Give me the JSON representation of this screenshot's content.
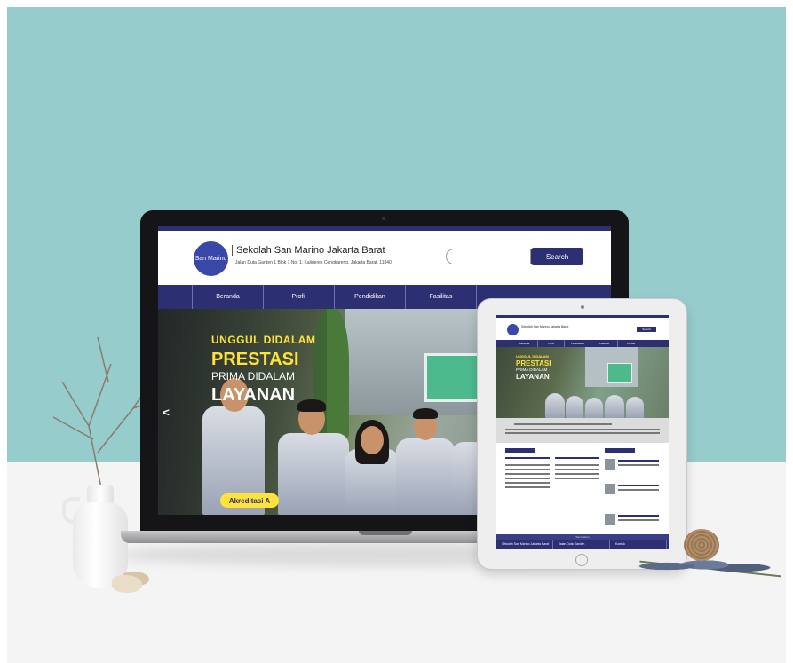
{
  "laptop_site": {
    "logo_text": "San Marino",
    "school_name": "Sekolah San Marino Jakarta Barat",
    "address": "Jalan Duta Garden 1 Blok 1 No. 1, Kalideres Cengkareng, Jakarta Barat, 11840",
    "search_button": "Search",
    "nav": [
      "Beranda",
      "Profil",
      "Pendidikan",
      "Fasilitas",
      ""
    ],
    "hero": {
      "line1": "UNGGUL DIDALAM",
      "line2": "PRESTASI",
      "line3": "PRIMA DIDALAM",
      "line4": "LAYANAN",
      "badge": "Akreditasi A",
      "prev_arrow": "<"
    }
  },
  "tablet_site": {
    "school_name": "Sekolah San Marino Jakarta Barat",
    "search_button": "Search",
    "nav": [
      "Beranda",
      "Profil",
      "Pendidikan",
      "Fasilitas",
      "Kontak"
    ],
    "hero": {
      "line1": "UNGGUL DIDALAM",
      "line2": "PRESTASI",
      "line3": "PRIMA DIDALAM",
      "line4": "LAYANAN"
    },
    "footer_bar": "San Marino",
    "footer": [
      "Sekolah San Marino Jakarta Barat",
      "Jalan Duta Garden",
      "Kontak"
    ]
  },
  "colors": {
    "brand_navy": "#2c2f72",
    "logo_blue": "#3948a8",
    "accent_yellow": "#ffe23a",
    "wall": "#97cccc"
  }
}
